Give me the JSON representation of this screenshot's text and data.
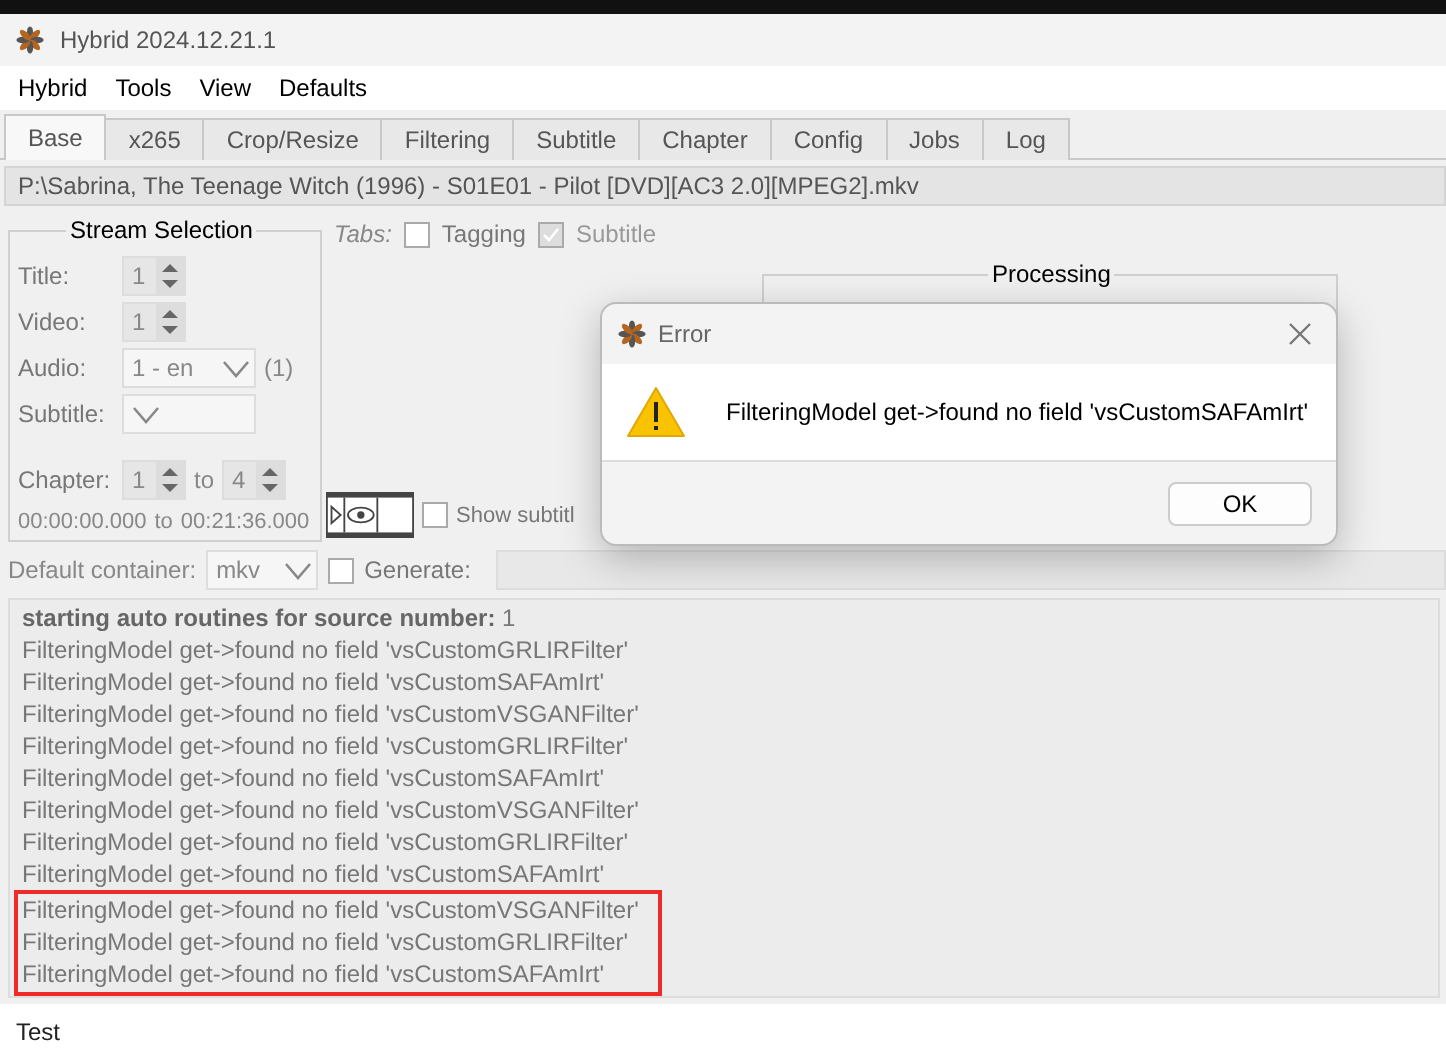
{
  "window": {
    "title": "Hybrid 2024.12.21.1"
  },
  "menu": [
    "Hybrid",
    "Tools",
    "View",
    "Defaults"
  ],
  "tabs": [
    {
      "label": "Base",
      "selected": true
    },
    {
      "label": "x265",
      "selected": false
    },
    {
      "label": "Crop/Resize",
      "selected": false
    },
    {
      "label": "Filtering",
      "selected": false
    },
    {
      "label": "Subtitle",
      "selected": false
    },
    {
      "label": "Chapter",
      "selected": false
    },
    {
      "label": "Config",
      "selected": false
    },
    {
      "label": "Jobs",
      "selected": false
    },
    {
      "label": "Log",
      "selected": false
    }
  ],
  "source_path": "P:\\Sabrina, The Teenage Witch (1996) - S01E01 - Pilot [DVD][AC3 2.0][MPEG2].mkv",
  "stream_selection": {
    "title": "Stream Selection",
    "rows": [
      {
        "kind": "spin",
        "label": "Title:",
        "value": "1"
      },
      {
        "kind": "spin",
        "label": "Video:",
        "value": "1"
      },
      {
        "kind": "combo",
        "label": "Audio:",
        "value": "1 - en",
        "note": "(1)"
      },
      {
        "kind": "combo",
        "label": "Subtitle:",
        "value": ""
      }
    ],
    "chapter": {
      "label": "Chapter:",
      "from": "1",
      "to_label": "to",
      "to": "4"
    },
    "time": {
      "start": "00:00:00.000",
      "to_label": "to",
      "end": "00:21:36.000"
    }
  },
  "tabs_options": {
    "label": "Tabs:",
    "items": [
      {
        "label": "Tagging",
        "checked": false,
        "disabled": false
      },
      {
        "label": "Subtitle",
        "checked": true,
        "disabled": true
      }
    ]
  },
  "show_subtitle": {
    "label": "Show subtitl",
    "checked": false
  },
  "processing": {
    "title": "Processing"
  },
  "default_container": {
    "label": "Default container:",
    "value": "mkv"
  },
  "generate": {
    "label": "Generate:",
    "checked": false
  },
  "log": [
    {
      "text": "**starting auto routines for source number:** 1",
      "highlighted": false
    },
    {
      "text": "FilteringModel get->found no field 'vsCustomGRLIRFilter'",
      "highlighted": false
    },
    {
      "text": "FilteringModel get->found no field 'vsCustomSAFAmIrt'",
      "highlighted": false
    },
    {
      "text": "FilteringModel get->found no field 'vsCustomVSGANFilter'",
      "highlighted": false
    },
    {
      "text": "FilteringModel get->found no field 'vsCustomGRLIRFilter'",
      "highlighted": false
    },
    {
      "text": "FilteringModel get->found no field 'vsCustomSAFAmIrt'",
      "highlighted": false
    },
    {
      "text": "FilteringModel get->found no field 'vsCustomVSGANFilter'",
      "highlighted": false
    },
    {
      "text": "FilteringModel get->found no field 'vsCustomGRLIRFilter'",
      "highlighted": false
    },
    {
      "text": "FilteringModel get->found no field 'vsCustomSAFAmIrt'",
      "highlighted": false
    },
    {
      "text": "FilteringModel get->found no field 'vsCustomVSGANFilter'",
      "highlighted": true
    },
    {
      "text": "FilteringModel get->found no field 'vsCustomGRLIRFilter'",
      "highlighted": true
    },
    {
      "text": "FilteringModel get->found no field 'vsCustomSAFAmIrt'",
      "highlighted": true
    }
  ],
  "status": "Test",
  "dialog": {
    "title": "Error",
    "message": "FilteringModel get->found no field 'vsCustomSAFAmIrt'",
    "buttons": [
      "OK"
    ]
  }
}
